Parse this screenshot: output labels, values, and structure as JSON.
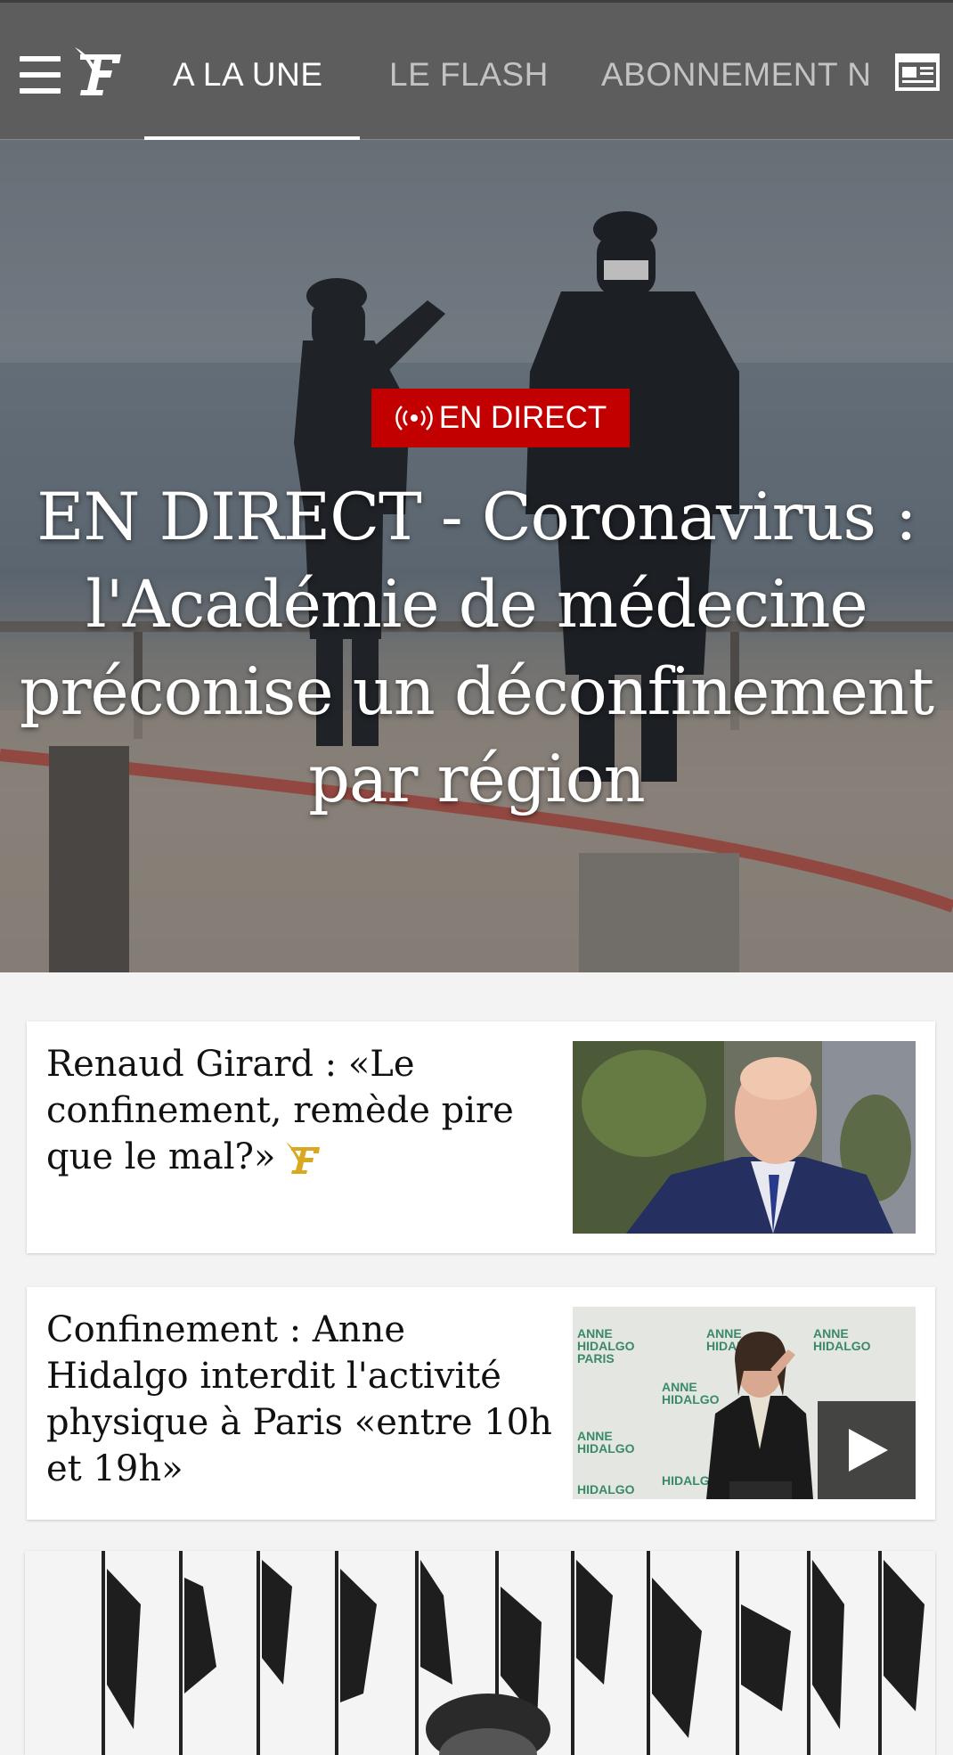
{
  "header": {
    "tabs": [
      {
        "label": "A LA UNE",
        "active": true
      },
      {
        "label": "LE FLASH",
        "active": false
      },
      {
        "label": "ABONNEMENT N",
        "active": false
      }
    ],
    "icons": [
      "menu-icon",
      "figaro-logo",
      "newspaper-icon"
    ]
  },
  "hero": {
    "badge_label": "EN DIRECT",
    "badge_color": "#c30000",
    "title": "EN DIRECT - Coronavirus : l'Académie de médecine préconise un déconfinement par région"
  },
  "articles": [
    {
      "title": "Renaud Girard : «Le confinement, remède pire que le mal?»",
      "premium_badge": "figaro-premium-icon",
      "has_video": false
    },
    {
      "title": "Confinement : Anne Hidalgo interdit l'activité physique à Paris «entre 10h et 19h»",
      "has_video": true,
      "thumbnail_backdrop_text": "ANNE HIDALGO PARIS EN COMMUN"
    },
    {
      "title": "",
      "has_video": false
    }
  ],
  "colors": {
    "topbar": "#5d5d5d",
    "accent_live": "#c30000",
    "premium_gold": "#d9a81e"
  }
}
